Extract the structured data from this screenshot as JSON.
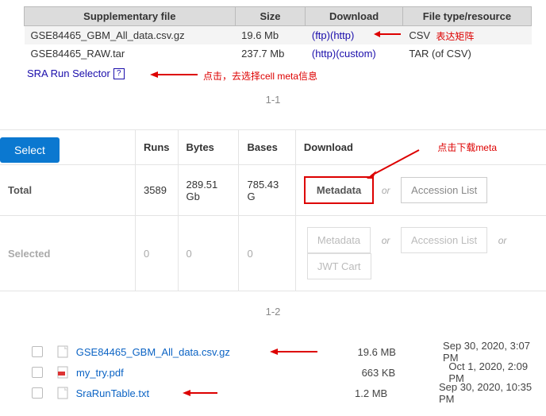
{
  "section1": {
    "headers": {
      "file": "Supplementary file",
      "size": "Size",
      "download": "Download",
      "type": "File type/resource"
    },
    "rows": [
      {
        "name": "GSE84465_GBM_All_data.csv.gz",
        "size": "19.6 Mb",
        "dl1": "(ftp)",
        "dl2": "(http)",
        "type": "CSV"
      },
      {
        "name": "GSE84465_RAW.tar",
        "size": "237.7 Mb",
        "dl1": "(http)",
        "dl2": "(custom)",
        "type": "TAR (of CSV)"
      }
    ],
    "sra_link": "SRA Run Selector",
    "note1": "表达矩阵",
    "note2": "点击，去选择cell meta信息",
    "label": "1-1"
  },
  "section2": {
    "select_btn": "Select",
    "headers": {
      "runs": "Runs",
      "bytes": "Bytes",
      "bases": "Bases",
      "download": "Download"
    },
    "total": {
      "label": "Total",
      "runs": "3589",
      "bytes": "289.51 Gb",
      "bases": "785.43 G"
    },
    "selected": {
      "label": "Selected",
      "runs": "0",
      "bytes": "0",
      "bases": "0"
    },
    "metadata_btn": "Metadata",
    "accession_btn": "Accession List",
    "jwt_btn": "JWT Cart",
    "or": "or",
    "note": "点击下载meta",
    "label": "1-2"
  },
  "section3": {
    "files": [
      {
        "name": "GSE84465_GBM_All_data.csv.gz",
        "size": "19.6 MB",
        "date": "Sep 30, 2020, 3:07 PM",
        "icon": "file"
      },
      {
        "name": "my_try.pdf",
        "size": "663 KB",
        "date": "Oct 1, 2020, 2:09 PM",
        "icon": "pdf"
      },
      {
        "name": "SraRunTable.txt",
        "size": "1.2 MB",
        "date": "Sep 30, 2020, 10:35 PM",
        "icon": "file"
      }
    ]
  }
}
